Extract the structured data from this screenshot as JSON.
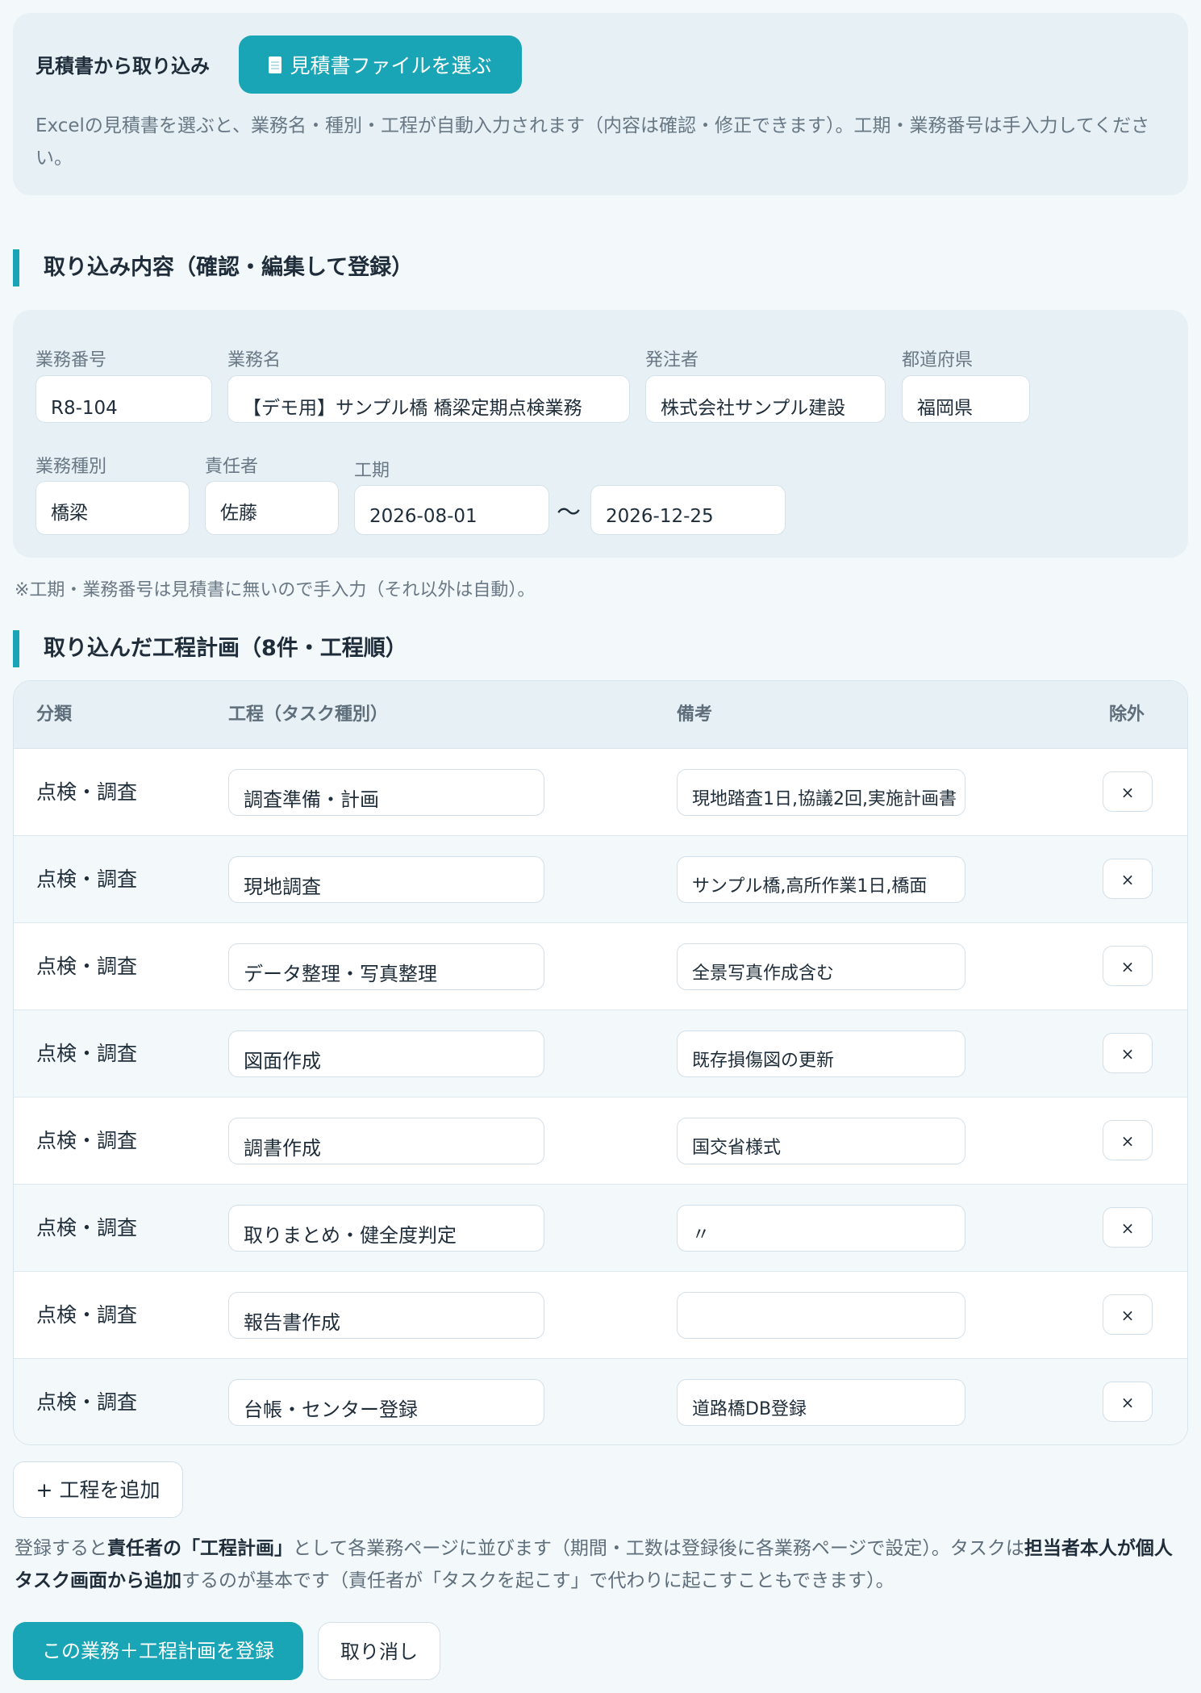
{
  "import_section": {
    "title": "見積書から取り込み",
    "file_button_label": "見積書ファイルを選ぶ",
    "description": "Excelの見積書を選ぶと、業務名・種別・工程が自動入力されます（内容は確認・修正できます）。工期・業務番号は手入力してください。"
  },
  "content_section": {
    "heading": "取り込み内容（確認・編集して登録）",
    "fields": {
      "job_number": {
        "label": "業務番号",
        "value": "R8-104"
      },
      "job_name": {
        "label": "業務名",
        "value": "【デモ用】サンプル橋 橋梁定期点検業務"
      },
      "client": {
        "label": "発注者",
        "value": "株式会社サンプル建設"
      },
      "prefecture": {
        "label": "都道府県",
        "value": "福岡県"
      },
      "job_type": {
        "label": "業務種別",
        "value": "橋梁"
      },
      "manager": {
        "label": "責任者",
        "value": "佐藤"
      },
      "period": {
        "label": "工期",
        "start": "2026-08-01",
        "separator": "〜",
        "end": "2026-12-25"
      }
    },
    "note": "※工期・業務番号は見積書に無いので手入力（それ以外は自動）。"
  },
  "process_section": {
    "heading": "取り込んだ工程計画（8件・工程順）",
    "columns": [
      "分類",
      "工程（タスク種別）",
      "備考",
      "除外"
    ],
    "rows": [
      {
        "category": "点検・調査",
        "task": "調査準備・計画",
        "memo": "現地踏査1日,協議2回,実施計画書",
        "remove": "×"
      },
      {
        "category": "点検・調査",
        "task": "現地調査",
        "memo": "サンプル橋,高所作業1日,橋面",
        "remove": "×"
      },
      {
        "category": "点検・調査",
        "task": "データ整理・写真整理",
        "memo": "全景写真作成含む",
        "remove": "×"
      },
      {
        "category": "点検・調査",
        "task": "図面作成",
        "memo": "既存損傷図の更新",
        "remove": "×"
      },
      {
        "category": "点検・調査",
        "task": "調書作成",
        "memo": "国交省様式",
        "remove": "×"
      },
      {
        "category": "点検・調査",
        "task": "取りまとめ・健全度判定",
        "memo": "〃",
        "remove": "×"
      },
      {
        "category": "点検・調査",
        "task": "報告書作成",
        "memo": "",
        "remove": "×"
      },
      {
        "category": "点検・調査",
        "task": "台帳・センター登録",
        "memo": "道路橋DB登録",
        "remove": "×"
      }
    ],
    "add_button_label": "+ 工程を追加"
  },
  "info_text": {
    "p1": "登録すると",
    "b1": "責任者の「工程計画」",
    "p2": "として各業務ページに並びます（期間・工数は登録後に各業務ページで設定）。タスクは",
    "b2": "担当者本人が個人タスク画面から追加",
    "p3": "するのが基本です（責任者が「タスクを起こす」で代わりに起こすこともできます）。"
  },
  "actions": {
    "submit_label": "この業務＋工程計画を登録",
    "cancel_label": "取り消し"
  },
  "colors": {
    "accent": "#19a5b5",
    "panel_bg": "#e6f0f5",
    "page_bg": "#f3f8fb"
  }
}
